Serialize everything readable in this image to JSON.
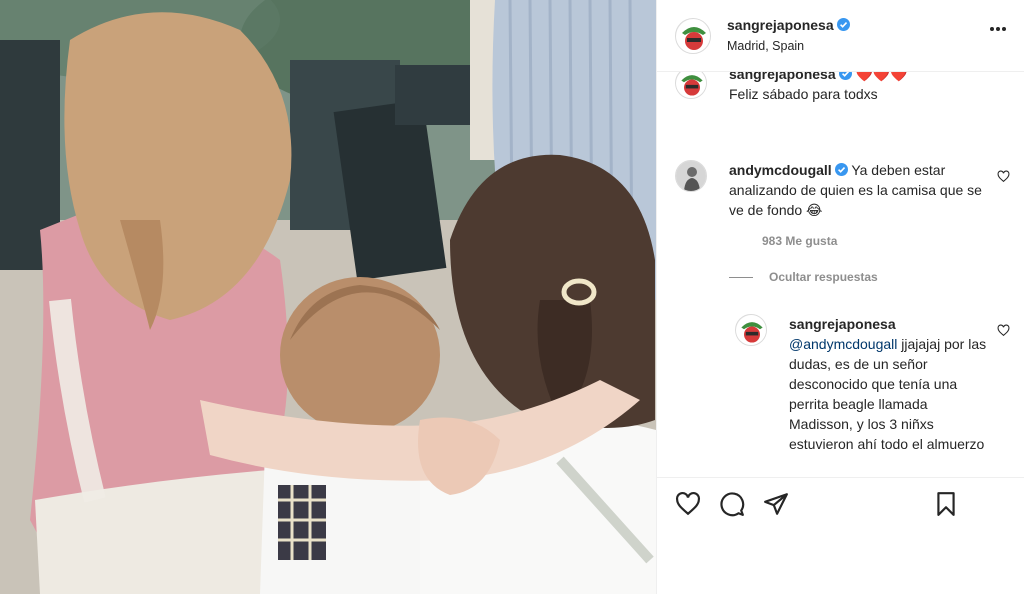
{
  "post": {
    "author": "sangrejaponesa",
    "location": "Madrid, Spain",
    "caption": {
      "username": "sangrejaponesa",
      "hearts": "❤️❤️❤️",
      "text": "Feliz sábado para todxs"
    }
  },
  "comments": [
    {
      "username": "andymcdougall",
      "text": "Ya deben estar analizando de quien es la camisa que se ve de fondo 😂",
      "likes": "983 Me gusta",
      "hide_replies_label": "Ocultar respuestas",
      "replies": [
        {
          "username": "sangrejaponesa",
          "mention": "@andymcdougall",
          "text": " jjajajaj por las dudas, es de un señor desconocido que tenía una perrita beagle llamada Madisson, y los 3 niñxs estuvieron ahí todo el almuerzo"
        }
      ]
    }
  ],
  "icons": {
    "verified": "verified-badge-icon",
    "more": "more-options-icon",
    "like": "heart-icon",
    "comment": "comment-icon",
    "share": "paper-plane-icon",
    "save": "bookmark-icon"
  },
  "colors": {
    "verified": "#3897f0",
    "mention": "#00376b",
    "muted": "#8e8e8e",
    "text": "#262626"
  }
}
